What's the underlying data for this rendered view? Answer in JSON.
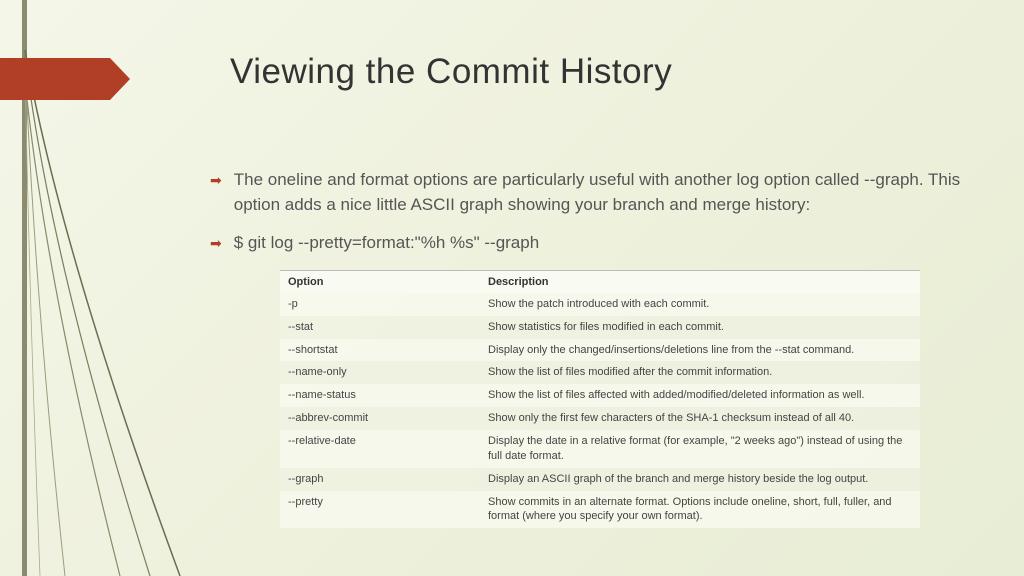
{
  "title": "Viewing the Commit History",
  "bullets": [
    "The oneline and format options are particularly useful with another log option called --graph. This option adds a nice little ASCII graph showing your branch and merge history:",
    "$ git log --pretty=format:\"%h %s\" --graph"
  ],
  "table": {
    "headers": [
      "Option",
      "Description"
    ],
    "rows": [
      [
        "-p",
        "Show the patch introduced with each commit."
      ],
      [
        "--stat",
        "Show statistics for files modified in each commit."
      ],
      [
        "--shortstat",
        "Display only the changed/insertions/deletions line from the --stat command."
      ],
      [
        "--name-only",
        "Show the list of files modified after the commit information."
      ],
      [
        "--name-status",
        "Show the list of files affected with added/modified/deleted information as well."
      ],
      [
        "--abbrev-commit",
        "Show only the first few characters of the SHA-1 checksum instead of all 40."
      ],
      [
        "--relative-date",
        "Display the date in a relative format (for example, \"2 weeks ago\") instead of using the full date format."
      ],
      [
        "--graph",
        "Display an ASCII graph of the branch and merge history beside the log output."
      ],
      [
        "--pretty",
        "Show commits in an alternate format. Options include oneline, short, full, fuller, and format (where you specify your own format)."
      ]
    ]
  }
}
